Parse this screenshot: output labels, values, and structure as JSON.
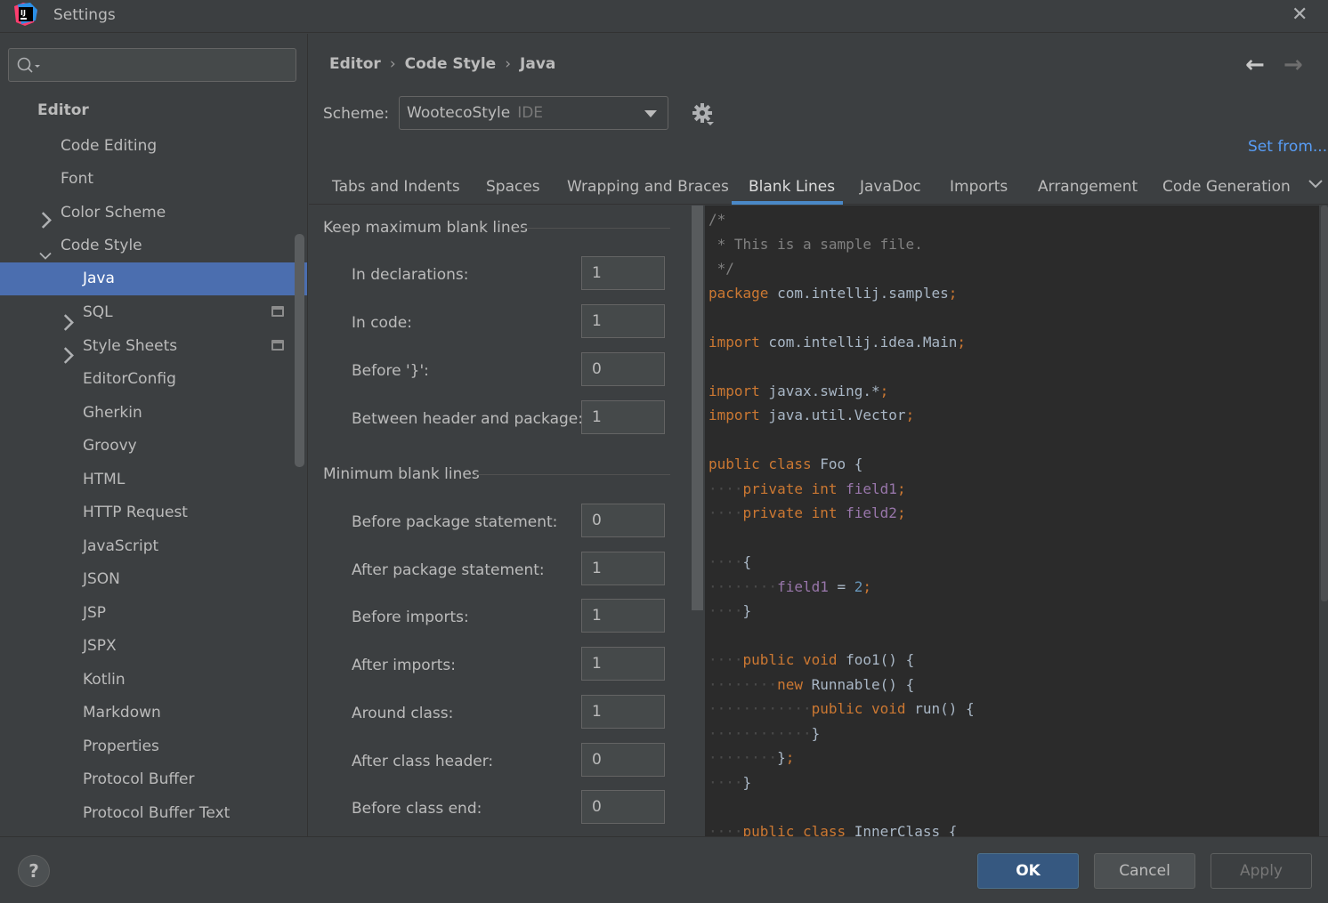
{
  "window": {
    "title": "Settings"
  },
  "search": {
    "placeholder": "",
    "value": ""
  },
  "sidebar": {
    "items": [
      {
        "label": "Editor"
      },
      {
        "label": "Code Editing"
      },
      {
        "label": "Font"
      },
      {
        "label": "Color Scheme"
      },
      {
        "label": "Code Style"
      },
      {
        "label": "Java"
      },
      {
        "label": "SQL"
      },
      {
        "label": "Style Sheets"
      },
      {
        "label": "EditorConfig"
      },
      {
        "label": "Gherkin"
      },
      {
        "label": "Groovy"
      },
      {
        "label": "HTML"
      },
      {
        "label": "HTTP Request"
      },
      {
        "label": "JavaScript"
      },
      {
        "label": "JSON"
      },
      {
        "label": "JSP"
      },
      {
        "label": "JSPX"
      },
      {
        "label": "Kotlin"
      },
      {
        "label": "Markdown"
      },
      {
        "label": "Properties"
      },
      {
        "label": "Protocol Buffer"
      },
      {
        "label": "Protocol Buffer Text"
      }
    ],
    "selected": "Java"
  },
  "breadcrumb": {
    "items": [
      "Editor",
      "Code Style",
      "Java"
    ],
    "separator": "›"
  },
  "nav": {
    "back": "←",
    "forward": "→"
  },
  "scheme": {
    "label": "Scheme:",
    "value": "WootecoStyle",
    "tag": "IDE",
    "set_from": "Set from..."
  },
  "tabs": {
    "items": [
      "Tabs and Indents",
      "Spaces",
      "Wrapping and Braces",
      "Blank Lines",
      "JavaDoc",
      "Imports",
      "Arrangement",
      "Code Generation"
    ],
    "active": "Blank Lines"
  },
  "keep_max": {
    "title": "Keep maximum blank lines",
    "fields": [
      {
        "label": "In declarations:",
        "value": "1"
      },
      {
        "label": "In code:",
        "value": "1"
      },
      {
        "label": "Before '}':",
        "value": "0"
      },
      {
        "label": "Between header and package:",
        "value": "1"
      }
    ]
  },
  "min_blank": {
    "title": "Minimum blank lines",
    "fields": [
      {
        "label": "Before package statement:",
        "value": "0"
      },
      {
        "label": "After package statement:",
        "value": "1"
      },
      {
        "label": "Before imports:",
        "value": "1"
      },
      {
        "label": "After imports:",
        "value": "1"
      },
      {
        "label": "Around class:",
        "value": "1"
      },
      {
        "label": "After class header:",
        "value": "0"
      },
      {
        "label": "Before class end:",
        "value": "0"
      }
    ]
  },
  "code_preview": {
    "lines": [
      [
        {
          "t": "/*",
          "c": "comment"
        }
      ],
      [
        {
          "t": " * This is a sample file.",
          "c": "comment"
        }
      ],
      [
        {
          "t": " */",
          "c": "comment"
        }
      ],
      [
        {
          "t": "package",
          "c": "kw"
        },
        {
          "t": " com.intellij.samples",
          "c": "plain"
        },
        {
          "t": ";",
          "c": "kw"
        }
      ],
      [],
      [
        {
          "t": "import",
          "c": "kw"
        },
        {
          "t": " com.intellij.idea.Main",
          "c": "plain"
        },
        {
          "t": ";",
          "c": "kw"
        }
      ],
      [],
      [
        {
          "t": "import",
          "c": "kw"
        },
        {
          "t": " javax.swing.*",
          "c": "plain"
        },
        {
          "t": ";",
          "c": "kw"
        }
      ],
      [
        {
          "t": "import",
          "c": "kw"
        },
        {
          "t": " java.util.Vector",
          "c": "plain"
        },
        {
          "t": ";",
          "c": "kw"
        }
      ],
      [],
      [
        {
          "t": "public class",
          "c": "kw"
        },
        {
          "t": " Foo {",
          "c": "plain"
        }
      ],
      [
        {
          "t": "····",
          "c": "ws"
        },
        {
          "t": "private int",
          "c": "kw"
        },
        {
          "t": " field1",
          "c": "field"
        },
        {
          "t": ";",
          "c": "kw"
        }
      ],
      [
        {
          "t": "····",
          "c": "ws"
        },
        {
          "t": "private int",
          "c": "kw"
        },
        {
          "t": " field2",
          "c": "field"
        },
        {
          "t": ";",
          "c": "kw"
        }
      ],
      [],
      [
        {
          "t": "····",
          "c": "ws"
        },
        {
          "t": "{",
          "c": "plain"
        }
      ],
      [
        {
          "t": "········",
          "c": "ws"
        },
        {
          "t": "field1",
          "c": "field"
        },
        {
          "t": " = ",
          "c": "plain"
        },
        {
          "t": "2",
          "c": "num"
        },
        {
          "t": ";",
          "c": "kw"
        }
      ],
      [
        {
          "t": "····",
          "c": "ws"
        },
        {
          "t": "}",
          "c": "plain"
        }
      ],
      [],
      [
        {
          "t": "····",
          "c": "ws"
        },
        {
          "t": "public void",
          "c": "kw"
        },
        {
          "t": " foo1() {",
          "c": "plain"
        }
      ],
      [
        {
          "t": "········",
          "c": "ws"
        },
        {
          "t": "new",
          "c": "kw"
        },
        {
          "t": " Runnable() {",
          "c": "plain"
        }
      ],
      [
        {
          "t": "············",
          "c": "ws"
        },
        {
          "t": "public void",
          "c": "kw"
        },
        {
          "t": " run() {",
          "c": "plain"
        }
      ],
      [
        {
          "t": "············",
          "c": "ws"
        },
        {
          "t": "}",
          "c": "plain"
        }
      ],
      [
        {
          "t": "········",
          "c": "ws"
        },
        {
          "t": "}",
          "c": "plain"
        },
        {
          "t": ";",
          "c": "kw"
        }
      ],
      [
        {
          "t": "····",
          "c": "ws"
        },
        {
          "t": "}",
          "c": "plain"
        }
      ],
      [],
      [
        {
          "t": "····",
          "c": "ws"
        },
        {
          "t": "public class",
          "c": "kw"
        },
        {
          "t": " InnerClass {",
          "c": "plain"
        }
      ]
    ]
  },
  "buttons": {
    "help": "?",
    "ok": "OK",
    "cancel": "Cancel",
    "apply": "Apply"
  },
  "colors": {
    "background": "#3c3f41",
    "editor_bg": "#2b2b2b",
    "selection": "#4b6eaf",
    "link": "#589df6",
    "keyword": "#cc7832",
    "comment": "#808080",
    "field": "#9876aa",
    "number": "#6897bb",
    "text": "#a9b7c6"
  }
}
